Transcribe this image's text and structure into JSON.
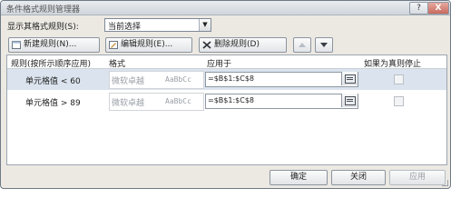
{
  "window": {
    "title": "条件格式规则管理器",
    "help_label": "?",
    "close_label": "X"
  },
  "scope": {
    "label": "显示其格式规则(S):",
    "selected": "当前选择"
  },
  "toolbar": {
    "new_rule": "新建规则(N)...",
    "edit_rule": "编辑规则(E)...",
    "delete_rule": "删除规则(D)"
  },
  "table": {
    "headers": [
      "规则(按所示顺序应用)",
      "格式",
      "应用于",
      "如果为真则停止"
    ],
    "rows": [
      {
        "rule": "单元格值 < 60",
        "preview_cn": "微软卓越",
        "preview_en": "AaBbCc",
        "applies_to": "=$B$1:$C$8",
        "stop_if_true": false,
        "selected": true
      },
      {
        "rule": "单元格值 > 89",
        "preview_cn": "微软卓越",
        "preview_en": "AaBbCc",
        "applies_to": "=$B$1:$C$8",
        "stop_if_true": false,
        "selected": false
      }
    ]
  },
  "buttons": {
    "ok": "确定",
    "close": "关闭",
    "apply": "应用"
  },
  "icons": {
    "new": "new-rule-icon",
    "edit": "edit-rule-icon",
    "delete": "delete-x-icon",
    "move_up": "move-up-icon",
    "move_down": "move-down-icon",
    "range_picker": "range-picker-icon"
  }
}
